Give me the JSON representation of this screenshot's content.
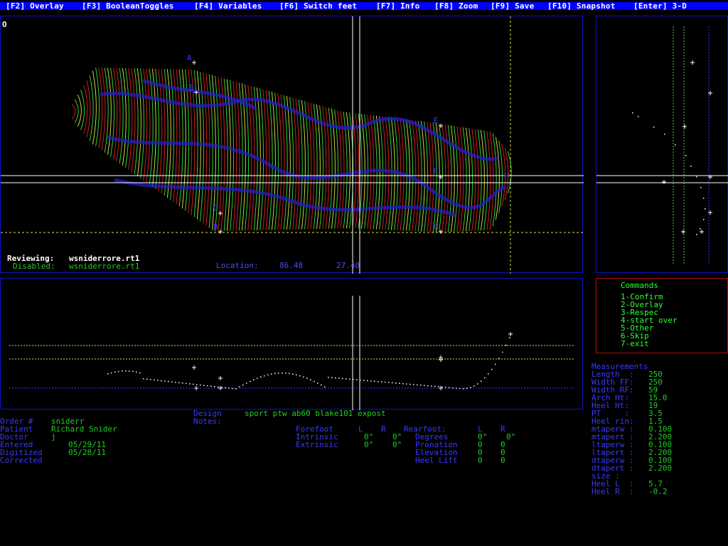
{
  "menu": [
    "[F2] Overlay",
    "[F3] BooleanToggles",
    "[F4] Variables",
    "[F6] Switch feet",
    "[F7] Info",
    "[F8] Zoom",
    "[F9] Save",
    "[F10] Snapshot",
    "[Enter] 3-D"
  ],
  "top_view": {
    "corner_mark": "O",
    "landmarks": [
      "A",
      "B",
      "C",
      "D",
      "E",
      "F",
      "G",
      "H"
    ],
    "reviewing_label": "Reviewing:",
    "reviewing_file": "wsniderrore.rt1",
    "disabled_label": "Disabled:",
    "disabled_file": "wsniderrore.rt1",
    "location_label": "Location:",
    "location_x": "86.48",
    "location_y": "27.40"
  },
  "commands": {
    "title": "Commands",
    "items": [
      "1-Confirm",
      "2-Overlay",
      "3-Respec",
      "4-start over",
      "5-Other",
      "6-Skip",
      "7-exit"
    ]
  },
  "measurements": {
    "title": "Measurements",
    "rows": [
      {
        "label": "Length  :",
        "value": "250"
      },
      {
        "label": "Width FF:",
        "value": "250"
      },
      {
        "label": "Width RF:",
        "value": "59"
      },
      {
        "label": "Arch Ht:",
        "value": "15.0"
      },
      {
        "label": "Heel Ht:",
        "value": "19"
      },
      {
        "label": "PT     :",
        "value": "3.5"
      },
      {
        "label": "Heel rin:",
        "value": "1.5"
      },
      {
        "label": "mtaperw :",
        "value": "0.100"
      },
      {
        "label": "mtapert :",
        "value": "2.200"
      },
      {
        "label": "ltaperw :",
        "value": "0.100"
      },
      {
        "label": "ltapert :",
        "value": "2.200"
      },
      {
        "label": "dtaperw :",
        "value": "0.100"
      },
      {
        "label": "dtapert :",
        "value": "2.200"
      },
      {
        "label": "size :",
        "value": ""
      },
      {
        "label": "Heel L  :",
        "value": "5.7"
      },
      {
        "label": "Heel R  :",
        "value": "-0.2"
      }
    ]
  },
  "order": {
    "order_label": "Order #",
    "order_value": "sniderr",
    "patient_label": "Patient",
    "patient_value": "Richard Snider",
    "doctor_label": "Doctor",
    "doctor_value": "j",
    "entered_label": "Entered",
    "entered_value": "05/29/11",
    "digitized_label": "Digitized",
    "digitized_value": "05/28/11",
    "corrected_label": "Corrected"
  },
  "design": {
    "design_label": "Design",
    "design_value": "sport ptw ab60 blake101 expost",
    "notes_label": "Notes:"
  },
  "forefoot": {
    "label": "Forefoot",
    "l": "L",
    "r": "R",
    "intrinsic_label": "Intrinsic",
    "intrinsic_l": "0°",
    "intrinsic_r": "0°",
    "extrinsic_label": "Extrinsic",
    "extrinsic_l": "0°",
    "extrinsic_r": "0°"
  },
  "rearfoot": {
    "label": "Rearfoot:",
    "l": "L",
    "r": "R",
    "degrees_label": "Degrees",
    "degrees_l": "0°",
    "degrees_r": "0°",
    "pronation_label": "Pronation",
    "pronation_l": "0",
    "pronation_r": "0",
    "elevation_label": "Elevation",
    "elevation_l": "0",
    "elevation_r": "0",
    "heel_lift_label": "Heel Lift",
    "heel_lift_l": "0",
    "heel_lift_r": "0"
  },
  "colors": {
    "menu_bg": "#0000ff",
    "panel_border": "#1010c8",
    "contour_red": "#e02020",
    "contour_green": "#30e030",
    "contour_yellow": "#e0e040",
    "contour_blue": "#2020c0",
    "label_blue": "#3a3aff",
    "value_green": "#22cc22"
  }
}
